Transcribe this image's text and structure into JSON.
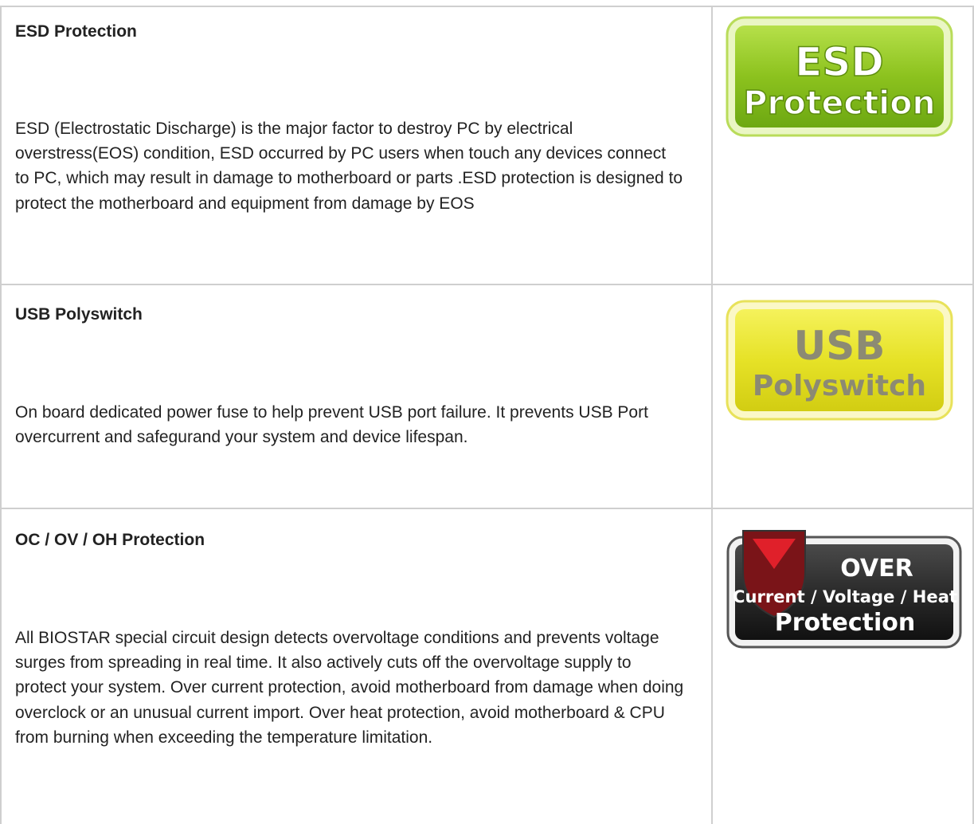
{
  "features": [
    {
      "title": "ESD Protection",
      "description": "ESD (Electrostatic Discharge) is the major factor to destroy PC by electrical overstress(EOS) condition, ESD occurred by PC users when touch any devices connect to PC, which may result in damage to motherboard or parts .ESD protection is designed to protect the motherboard and equipment from damage by EOS",
      "badge_line1": "ESD",
      "badge_line2": "Protection",
      "badge_icon": "esd-protection-badge-icon"
    },
    {
      "title": "USB Polyswitch",
      "description": "On board dedicated power fuse to help prevent USB port failure. It prevents USB Port overcurrent and safegurand your system and device lifespan.",
      "badge_line1": "USB",
      "badge_line2": "Polyswitch",
      "badge_icon": "usb-polyswitch-badge-icon"
    },
    {
      "title": "OC / OV / OH Protection",
      "description": "All BIOSTAR special circuit design detects overvoltage conditions and prevents voltage surges from spreading in real time. It also actively cuts off the overvoltage supply to protect your system. Over current protection, avoid motherboard from damage when doing overclock or an unusual current import. Over heat protection, avoid motherboard & CPU from burning when exceeding the temperature limitation.",
      "badge_line1": "OVER",
      "badge_line2": "Current / Voltage / Heat",
      "badge_line3": "Protection",
      "badge_icon": "over-protection-shield-badge-icon"
    }
  ],
  "colors": {
    "esd_green": "#8cc21e",
    "usb_yellow": "#e6e227",
    "over_dark": "#2b2b2b",
    "shield_red": "#d11b24",
    "border": "#cfcfcf"
  }
}
